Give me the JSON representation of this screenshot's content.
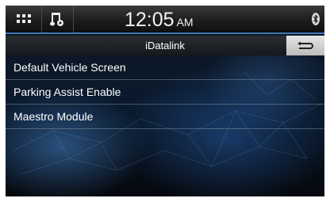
{
  "statusbar": {
    "menu_icon": "grid-menu-icon",
    "music_icon": "music-settings-icon",
    "time": "12:05",
    "ampm": "AM",
    "bluetooth_icon": "bluetooth-icon"
  },
  "titlebar": {
    "title": "iDatalink",
    "back_icon": "back-arrow-icon"
  },
  "menu": {
    "items": [
      {
        "label": "Default Vehicle Screen"
      },
      {
        "label": "Parking Assist Enable"
      },
      {
        "label": "Maestro Module"
      }
    ]
  },
  "colors": {
    "accent": "#3f77b5",
    "background": "#0a1a2e",
    "text": "#ffffff"
  }
}
